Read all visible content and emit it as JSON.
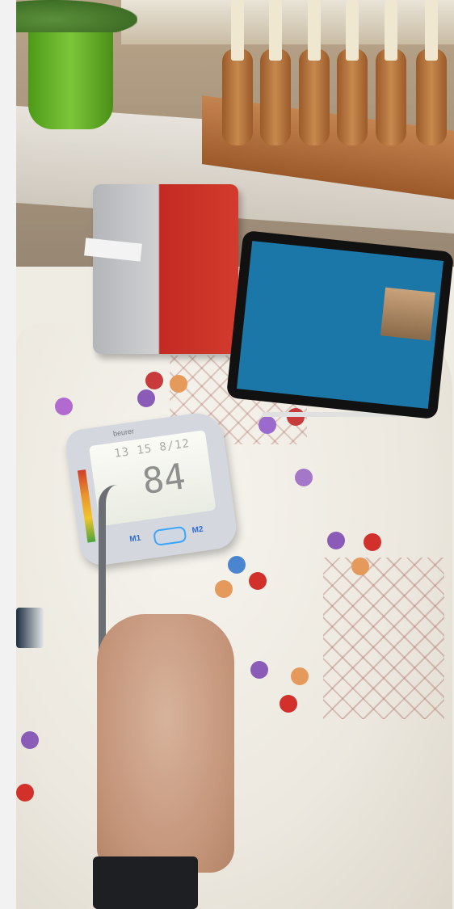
{
  "photo": {
    "monitor_brand": "beurer",
    "display_top_readout": "13 15 8/12",
    "display_main_value": "84",
    "memory_button_1": "M1",
    "memory_button_2": "M2"
  }
}
